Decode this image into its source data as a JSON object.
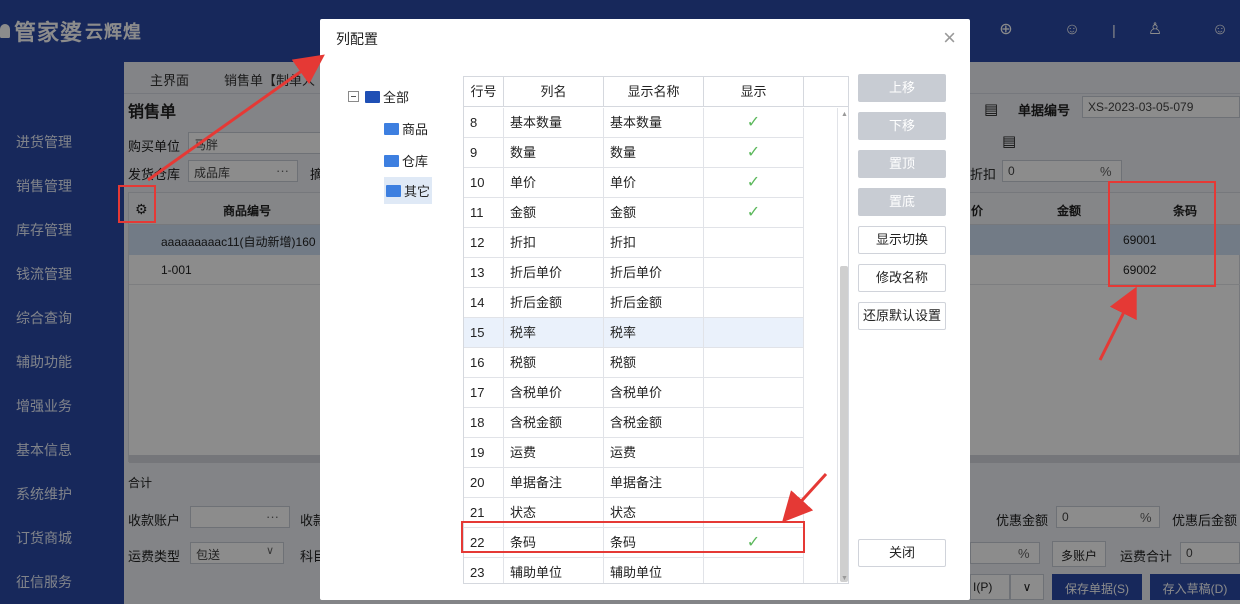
{
  "app": {
    "logo_main": "管家婆",
    "logo_sub": "云辉煌",
    "top_icons": [
      "add-circle-icon",
      "chat-icon",
      "person-icon",
      "smile-icon"
    ],
    "top_separator": "|"
  },
  "sidebar": {
    "items": [
      "进货管理",
      "销售管理",
      "库存管理",
      "钱流管理",
      "综合查询",
      "辅助功能",
      "增强业务",
      "基本信息",
      "系统维护",
      "订货商城",
      "征信服务"
    ]
  },
  "main": {
    "breadcrumbs": [
      "主界面",
      "销售单【制单人"
    ],
    "title": "销售单",
    "fields": {
      "buyer_label": "购买单位",
      "buyer_value": "马胖",
      "warehouse_label": "发货仓库",
      "warehouse_value": "成品库",
      "warehouse_ellipsis": "···",
      "note_label": "摘",
      "doc_no_label": "单据编号",
      "doc_no_value": "XS-2023-03-05-079",
      "discount_label": "折扣",
      "discount_value": "0",
      "discount_unit": "%",
      "collect_account_label": "收款账户",
      "collect_account_ellipsis": "···",
      "collect_label": "收款",
      "freight_type_label": "运费类型",
      "freight_type_value": "包送",
      "subject_label": "科目",
      "promo_amount_label": "优惠金额",
      "promo_amount_value": "0",
      "promo_unit": "%",
      "after_promo_label": "优惠后金额",
      "freight_percent_unit": "%",
      "multi_account_btn": "多账户",
      "freight_total_label": "运费合计",
      "freight_total_value": "0",
      "total_label": "合计"
    },
    "grid": {
      "settings_icon": "gear-icon",
      "columns": [
        "商品编号",
        "价",
        "金额",
        "条码"
      ],
      "rows": [
        {
          "code": "aaaaaaaaac11(自动新增)160",
          "barcode": "69001"
        },
        {
          "code": "1-001",
          "barcode": "69002"
        }
      ]
    },
    "bottom_buttons": {
      "print_tail": "I(P)",
      "dropdown_icon": "chevron-down-icon",
      "save": "保存单据(S)",
      "draft": "存入草稿(D)"
    }
  },
  "dialog": {
    "title": "列配置",
    "close_symbol": "×",
    "tree": {
      "root": "全部",
      "root_toggle": "−",
      "children": [
        "商品",
        "仓库",
        "其它"
      ]
    },
    "table": {
      "headers": [
        "行号",
        "列名",
        "显示名称",
        "显示"
      ],
      "check_mark": "✓",
      "rows": [
        {
          "no": "8",
          "name": "基本数量",
          "display": "基本数量",
          "shown": true
        },
        {
          "no": "9",
          "name": "数量",
          "display": "数量",
          "shown": true
        },
        {
          "no": "10",
          "name": "单价",
          "display": "单价",
          "shown": true
        },
        {
          "no": "11",
          "name": "金额",
          "display": "金额",
          "shown": true
        },
        {
          "no": "12",
          "name": "折扣",
          "display": "折扣",
          "shown": false
        },
        {
          "no": "13",
          "name": "折后单价",
          "display": "折后单价",
          "shown": false
        },
        {
          "no": "14",
          "name": "折后金额",
          "display": "折后金额",
          "shown": false
        },
        {
          "no": "15",
          "name": "税率",
          "display": "税率",
          "shown": false
        },
        {
          "no": "16",
          "name": "税额",
          "display": "税额",
          "shown": false
        },
        {
          "no": "17",
          "name": "含税单价",
          "display": "含税单价",
          "shown": false
        },
        {
          "no": "18",
          "name": "含税金额",
          "display": "含税金额",
          "shown": false
        },
        {
          "no": "19",
          "name": "运费",
          "display": "运费",
          "shown": false
        },
        {
          "no": "20",
          "name": "单据备注",
          "display": "单据备注",
          "shown": false
        },
        {
          "no": "21",
          "name": "状态",
          "display": "状态",
          "shown": false
        },
        {
          "no": "22",
          "name": "条码",
          "display": "条码",
          "shown": true
        },
        {
          "no": "23",
          "name": "辅助单位",
          "display": "辅助单位",
          "shown": false
        }
      ]
    },
    "buttons": {
      "move_up": "上移",
      "move_down": "下移",
      "to_top": "置顶",
      "to_bottom": "置底",
      "toggle_display": "显示切换",
      "rename": "修改名称",
      "restore_default": "还原默认设置",
      "close": "关闭"
    }
  },
  "colors": {
    "nav_bg": "#2b4aa6",
    "highlight": "#e53935",
    "check": "#5cb85c"
  }
}
